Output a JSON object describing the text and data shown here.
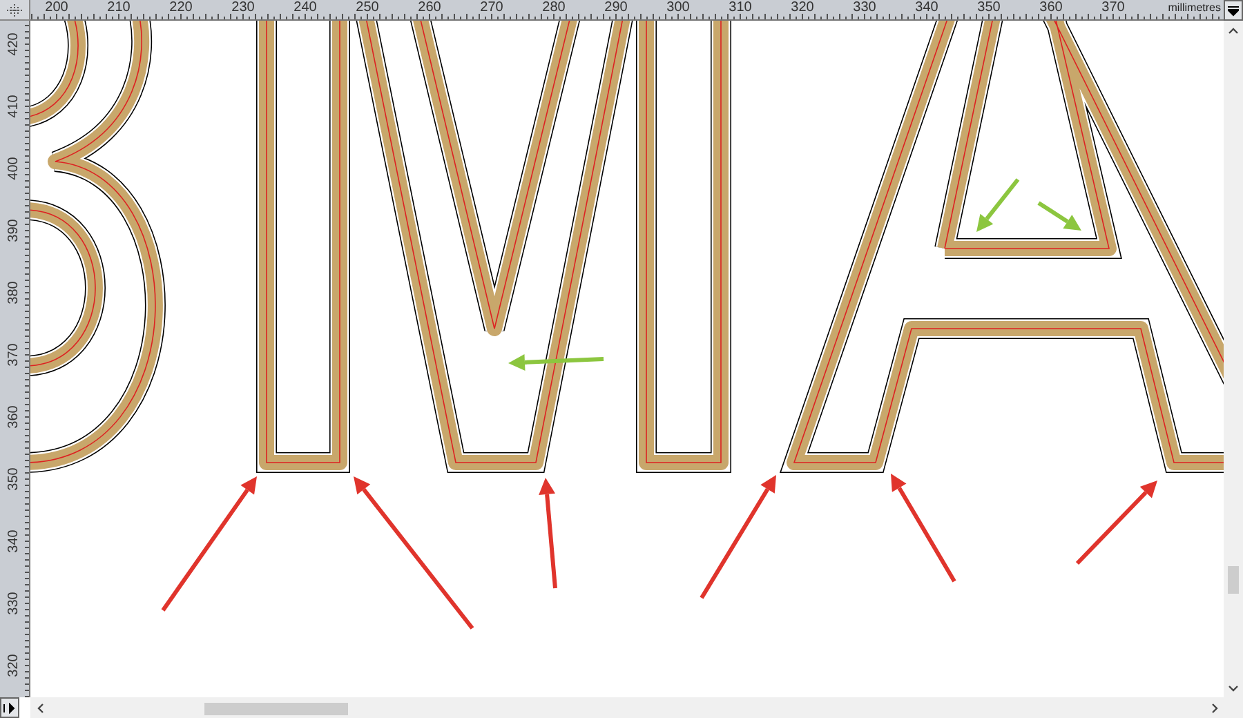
{
  "top_ruler": {
    "labels": [
      "200",
      "210",
      "220",
      "230",
      "240",
      "250",
      "260",
      "270",
      "280",
      "290",
      "300",
      "310",
      "320",
      "330",
      "340",
      "350",
      "360",
      "370"
    ],
    "units": "millimetres"
  },
  "left_ruler": {
    "labels": [
      "420",
      "410",
      "400",
      "390",
      "380",
      "370",
      "360",
      "350",
      "340",
      "330",
      "320"
    ]
  }
}
